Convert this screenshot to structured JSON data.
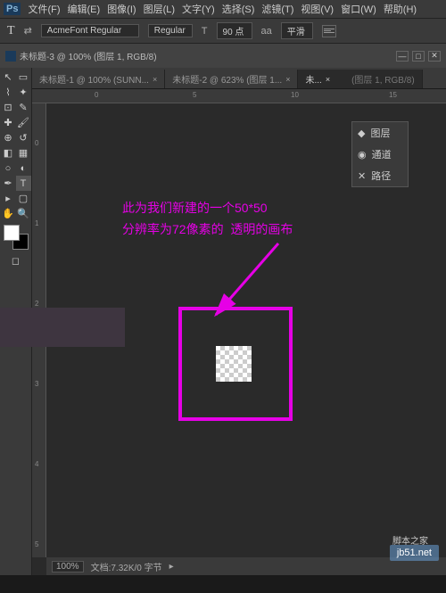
{
  "menu": {
    "ps": "Ps",
    "items": [
      "文件(F)",
      "编辑(E)",
      "图像(I)",
      "图层(L)",
      "文字(Y)",
      "选择(S)",
      "滤镜(T)",
      "视图(V)",
      "窗口(W)",
      "帮助(H)"
    ]
  },
  "options": {
    "font": "AcmeFont Regular",
    "style": "Regular",
    "sizeLabel": "T",
    "size": "90 点",
    "aa": "平滑"
  },
  "mainTab": "未标题-3 @ 100% (图层 1, RGB/8)",
  "docTabs": [
    {
      "label": "未标题-1 @ 100% (SUNN...",
      "active": false
    },
    {
      "label": "未标题-2 @ 623% (图层 1...",
      "active": false
    },
    {
      "label": "未...",
      "active": true,
      "suffix": "(图层 1, RGB/8)"
    }
  ],
  "rulerH": {
    "0": 0,
    "5": 5,
    "10": 10,
    "15": 15
  },
  "rulerV": {
    "0": 0,
    "1": 1,
    "2": 2,
    "3": 3,
    "4": 4,
    "5": 5
  },
  "panel": {
    "layer": "图层",
    "channel": "通道",
    "path": "路径"
  },
  "annotation": {
    "line1_a": "此为我们新建的一个",
    "line1_b": "50*50",
    "line2_a": "分辨率为",
    "line2_b": "72像素",
    "line2_c": "的",
    "line2_d": "透明",
    "line2_e": "的画布"
  },
  "status": {
    "zoom": "100%",
    "doc": "文档:7.32K/0 字节"
  },
  "watermark": {
    "text1": "脚本之家",
    "text2": "jb51.net"
  }
}
